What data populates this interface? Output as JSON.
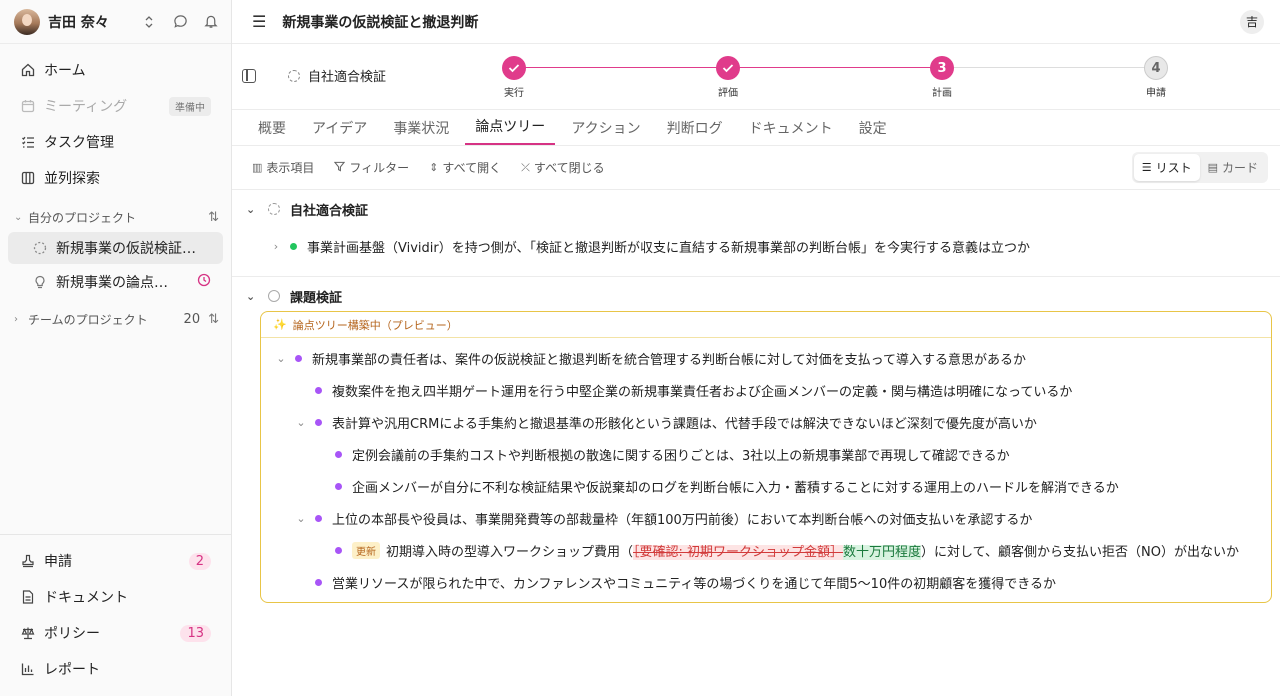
{
  "sidebar": {
    "user_name": "吉田 奈々",
    "nav": [
      {
        "label": "ホーム",
        "icon": "home-icon"
      },
      {
        "label": "ミーティング",
        "icon": "calendar-icon",
        "badge": "準備中"
      },
      {
        "label": "タスク管理",
        "icon": "task-list-icon"
      },
      {
        "label": "並列探索",
        "icon": "columns-icon"
      }
    ],
    "my_projects_label": "自分のプロジェクト",
    "projects": [
      {
        "label": "新規事業の仮説検証…"
      },
      {
        "label": "新規事業の論点…"
      }
    ],
    "team_projects_label": "チームのプロジェクト",
    "team_projects_count": "20",
    "bottom": [
      {
        "label": "申請",
        "icon": "stamp-icon",
        "badge": "2"
      },
      {
        "label": "ドキュメント",
        "icon": "document-icon"
      },
      {
        "label": "ポリシー",
        "icon": "scale-icon",
        "badge": "13"
      },
      {
        "label": "レポート",
        "icon": "bar-chart-icon"
      }
    ]
  },
  "header": {
    "title": "新規事業の仮説検証と撤退判断",
    "user_initial": "吉"
  },
  "stepper": {
    "current_label": "自社適合検証",
    "steps": [
      {
        "label": "実行",
        "state": "done",
        "num": "✓"
      },
      {
        "label": "評価",
        "state": "done",
        "num": "✓"
      },
      {
        "label": "計画",
        "state": "current",
        "num": "3"
      },
      {
        "label": "申請",
        "state": "todo",
        "num": "4"
      }
    ],
    "accent": "#e03b8b"
  },
  "tabs": [
    "概要",
    "アイデア",
    "事業状況",
    "論点ツリー",
    "アクション",
    "判断ログ",
    "ドキュメント",
    "設定"
  ],
  "toolbar": {
    "columns": "表示項目",
    "filter": "フィルター",
    "expand_all": "すべて開く",
    "collapse_all": "すべて閉じる",
    "view_list": "リスト",
    "view_card": "カード"
  },
  "groups": {
    "g1_title": "自社適合検証",
    "g1_row": "事業計画基盤（Vividir）を持つ側が、「検証と撤退判断が収支に直結する新規事業部の判断台帳」を今実行する意義は立つか",
    "g2_title": "課題検証",
    "preview_label": "論点ツリー構築中（プレビュー）",
    "r1": "新規事業部の責任者は、案件の仮説検証と撤退判断を統合管理する判断台帳に対して対価を支払って導入する意思があるか",
    "r2": "複数案件を抱え四半期ゲート運用を行う中堅企業の新規事業責任者および企画メンバーの定義・関与構造は明確になっているか",
    "r3": "表計算や汎用CRMによる手集約と撤退基準の形骸化という課題は、代替手段では解決できないほど深刻で優先度が高いか",
    "r4": "定例会議前の手集約コストや判断根拠の散逸に関する困りごとは、3社以上の新規事業部で再現して確認できるか",
    "r5": "企画メンバーが自分に不利な検証結果や仮説棄却のログを判断台帳に入力・蓄積することに対する運用上のハードルを解消できるか",
    "r6": "上位の本部長や役員は、事業開発費等の部裁量枠（年額100万円前後）において本判断台帳への対価支払いを承認するか",
    "r7_tag": "更新",
    "r7_pre": "初期導入時の型導入ワークショップ費用（",
    "r7_del": "［要確認: 初期ワークショップ金額］",
    "r7_ins": "数十万円程度",
    "r7_post": "）に対して、顧客側から支払い拒否（NO）が出ないか",
    "r8": "営業リソースが限られた中で、カンファレンスやコミュニティ等の場づくりを通じて年間5～10件の初期顧客を獲得できるか"
  },
  "colors": {
    "green": "#22c55e",
    "purple": "#a855f7",
    "pink": "#e03b8b"
  }
}
